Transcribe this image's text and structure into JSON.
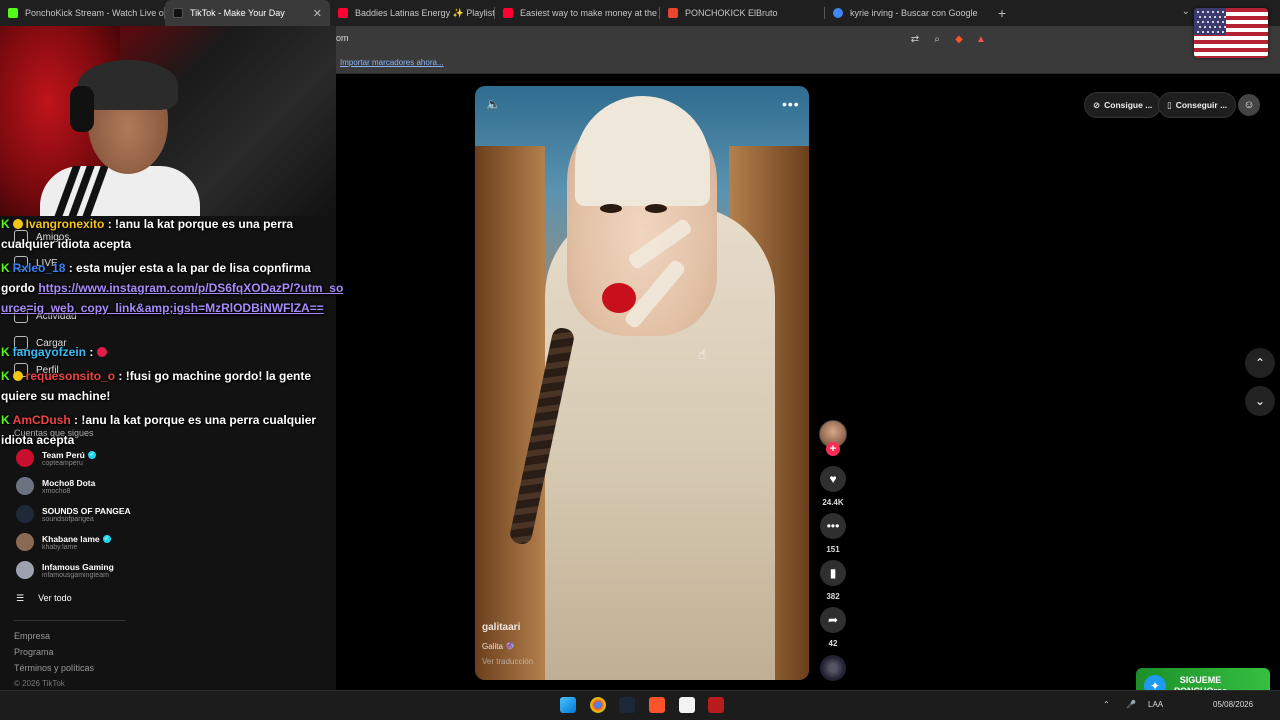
{
  "browser": {
    "tabs": [
      {
        "title": "PonchoKick Stream - Watch Live on K",
        "icon_color": "#53fc18",
        "active": false
      },
      {
        "title": "TikTok - Make Your Day",
        "icon_color": "#111111",
        "active": true
      },
      {
        "title": "Baddies Latinas Energy ✨ Playlist [I",
        "icon_color": "#ff0033",
        "active": false
      },
      {
        "title": "Easiest way to make money at the ca",
        "icon_color": "#ff0033",
        "active": false
      },
      {
        "title": "PONCHOKICK ElBruto",
        "icon_color": "#e9452f",
        "active": false
      },
      {
        "title": "kyrie irving - Buscar con Google",
        "icon_color": "#4285f4",
        "active": false
      }
    ],
    "new_tab": "+",
    "close_glyph": "✕",
    "url_fragment": "om",
    "bookmark_import": "Importar marcadores ahora..."
  },
  "sidebar": {
    "nav": [
      {
        "label": "Amigos",
        "icon": "friends-icon"
      },
      {
        "label": "LIVE",
        "icon": "live-icon"
      },
      {
        "label": "Actividad",
        "icon": "activity-icon"
      },
      {
        "label": "Cargar",
        "icon": "upload-icon"
      },
      {
        "label": "Perfil",
        "icon": "profile-icon"
      }
    ],
    "following_title": "Cuentas que sigues",
    "accounts": [
      {
        "name": "Team Perú",
        "handle": "copteamperu",
        "verified": true,
        "color": "#c8102e"
      },
      {
        "name": "Mocho8 Dota",
        "handle": "xmocho8",
        "verified": false,
        "color": "#6b7280"
      },
      {
        "name": "SOUNDS OF PANGEA",
        "handle": "soundsofpangea",
        "verified": false,
        "color": "#1f2937"
      },
      {
        "name": "Khabane lame",
        "handle": "khaby.lame",
        "verified": true,
        "color": "#8a6a52"
      },
      {
        "name": "Infamous Gaming",
        "handle": "infamousgamingteam",
        "verified": false,
        "color": "#9ca3af"
      }
    ],
    "see_all": "Ver todo",
    "footer": [
      "Empresa",
      "Programa",
      "Términos y políticas"
    ],
    "copyright": "© 2026 TikTok"
  },
  "chat": {
    "messages": [
      {
        "user": "Ivangronexito",
        "user_color": "#f5c518",
        "text": "!anu la kat porque es una perra cualquier idiota acepta"
      },
      {
        "user": "Rxleo_18",
        "user_color": "#3b82f6",
        "text": "esta mujer esta a la par de lisa copnfirma gordo",
        "link": "https://www.instagram.com/p/DS6fqXODazP/?utm_source=ig_web_copy_link&amp;igsh=MzRlODBiNWFlZA=="
      },
      {
        "user": "fangayofzein",
        "user_color": "#38bdf8",
        "text": ""
      },
      {
        "user": "requesonsito_o",
        "user_color": "#ef4444",
        "text": "!fusi go machine gordo! la gente quiere su machine!"
      },
      {
        "user": "AmCDush",
        "user_color": "#ef4444",
        "text": "!anu la kat porque es una perra cualquier idiota acepta"
      }
    ]
  },
  "video": {
    "sound_icon": "🔈",
    "more_icon": "•••",
    "author": "galitaari",
    "caption": "Galita 🔮",
    "translate": "Ver traducción",
    "likes": "24.4K",
    "comments": "151",
    "saves": "382",
    "shares": "42"
  },
  "top_actions": {
    "get_app": "Consigue ...",
    "get_coins": "Conseguir ..."
  },
  "overlay": {
    "twitter_line1": "SIGUEME",
    "twitter_line2": "PONCHOrec"
  },
  "taskbar": {
    "lang": "LAA",
    "date": "05/08/2026"
  }
}
